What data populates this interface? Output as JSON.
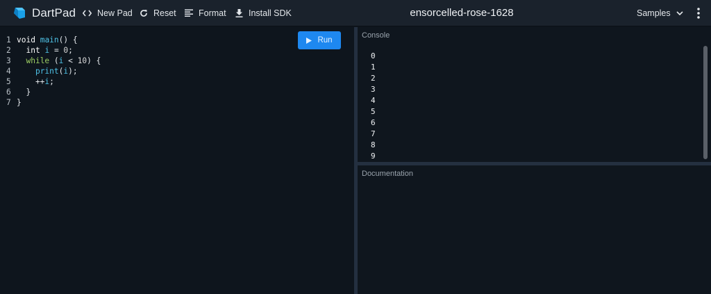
{
  "app": {
    "name": "DartPad"
  },
  "toolbar": {
    "new_pad": "New Pad",
    "reset": "Reset",
    "format": "Format",
    "install_sdk": "Install SDK"
  },
  "pad_title": "ensorcelled-rose-1628",
  "samples_label": "Samples",
  "run_label": "Run",
  "editor": {
    "lines": [
      {
        "n": "1",
        "text": "void main() {"
      },
      {
        "n": "2",
        "text": "  int i = 0;"
      },
      {
        "n": "3",
        "text": "  while (i < 10) {"
      },
      {
        "n": "4",
        "text": "    print(i);"
      },
      {
        "n": "5",
        "text": "    ++i;"
      },
      {
        "n": "6",
        "text": "  }"
      },
      {
        "n": "7",
        "text": "}"
      }
    ]
  },
  "console": {
    "title": "Console",
    "output": [
      "0",
      "1",
      "2",
      "3",
      "4",
      "5",
      "6",
      "7",
      "8",
      "9"
    ]
  },
  "documentation": {
    "title": "Documentation"
  },
  "colors": {
    "accent": "#1e88f0",
    "background": "#0e151d",
    "header": "#1a222c",
    "keyword_green": "#9ccd63",
    "identifier_cyan": "#4fc3e8"
  }
}
